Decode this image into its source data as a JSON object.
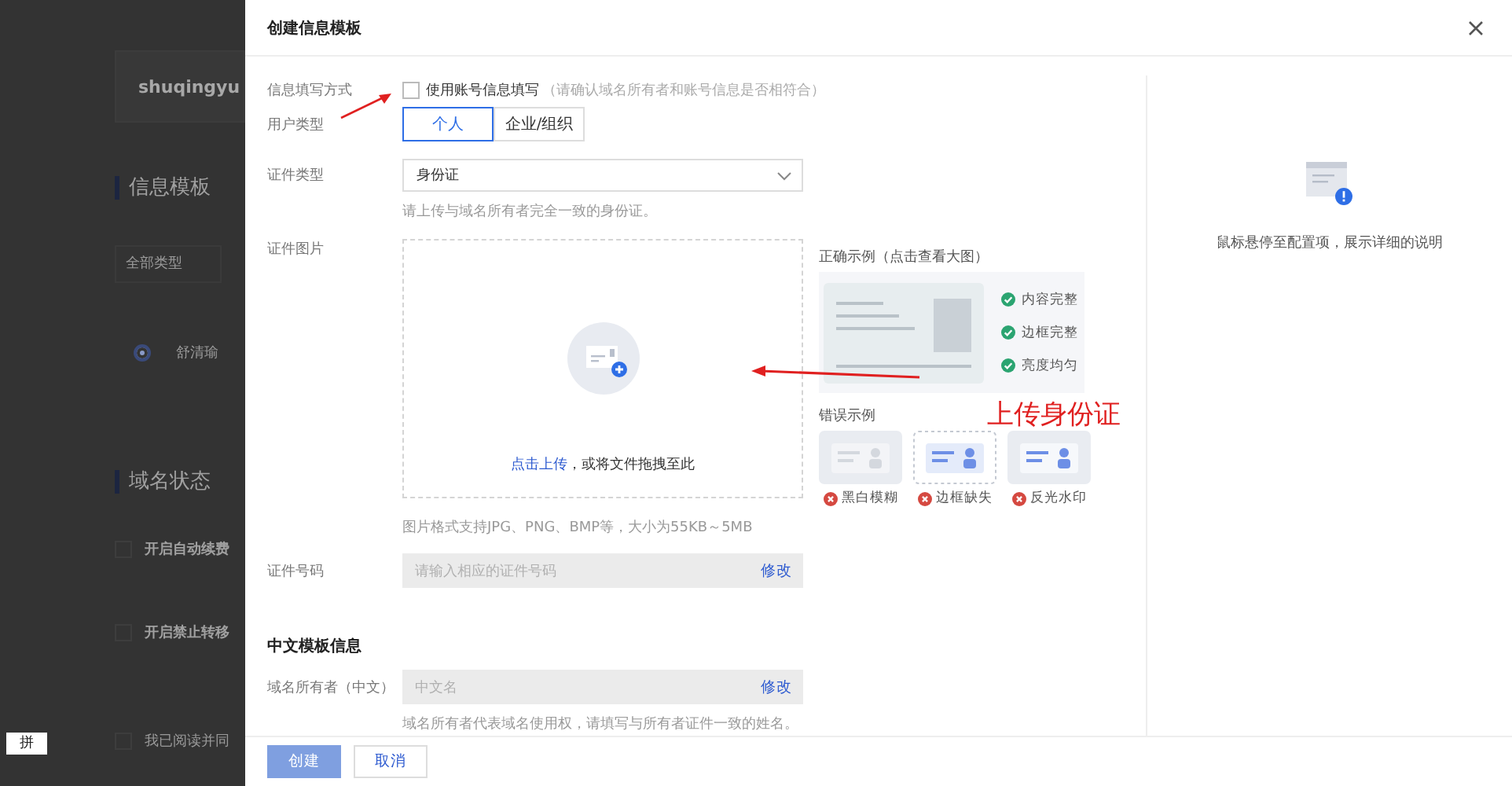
{
  "background_page": {
    "account": "shuqingyu",
    "template_title": "信息模板",
    "type_filter": "全部类型",
    "templates": [
      {
        "name": "舒清瑜",
        "selected": true
      }
    ],
    "status_title": "域名状态",
    "options": [
      {
        "label": "开启自动续费",
        "checked": false
      },
      {
        "label": "开启禁止转移",
        "checked": false
      }
    ],
    "agreement": {
      "label": "我已阅读并同",
      "checked": false
    },
    "ime_indicator": "拼"
  },
  "dialog": {
    "title": "创建信息模板",
    "form": {
      "fill_method": {
        "label": "信息填写方式",
        "checkbox": {
          "label": "使用账号信息填写",
          "checked": false
        },
        "hint": "（请确认域名所有者和账号信息是否相符合）"
      },
      "user_type": {
        "label": "用户类型",
        "options": [
          {
            "label": "个人",
            "selected": true
          },
          {
            "label": "企业/组织",
            "selected": false
          }
        ]
      },
      "id_type": {
        "label": "证件类型",
        "value": "身份证",
        "help": "请上传与域名所有者完全一致的身份证。"
      },
      "id_image": {
        "label": "证件图片",
        "upload_link": "点击上传",
        "upload_text": "，或将文件拖拽至此",
        "format_hint": "图片格式支持JPG、PNG、BMP等，大小为55KB～5MB",
        "correct_example": {
          "title": "正确示例（点击查看大图）",
          "checks": [
            "内容完整",
            "边框完整",
            "亮度均匀"
          ]
        },
        "wrong_example": {
          "title": "错误示例",
          "items": [
            "黑白模糊",
            "边框缺失",
            "反光水印"
          ]
        }
      },
      "id_number": {
        "label": "证件号码",
        "placeholder": "请输入相应的证件号码",
        "action": "修改"
      },
      "section_title": "中文模板信息",
      "owner_cn": {
        "label": "域名所有者（中文）",
        "placeholder": "中文名",
        "action": "修改",
        "help": "域名所有者代表域名使用权，请填写与所有者证件一致的姓名。"
      }
    },
    "help_panel": {
      "text": "鼠标悬停至配置项，展示详细的说明"
    },
    "buttons": [
      {
        "label": "创建",
        "disabled": true
      },
      {
        "label": "取消",
        "disabled": false
      }
    ]
  },
  "annotation": {
    "text": "上传身份证"
  }
}
